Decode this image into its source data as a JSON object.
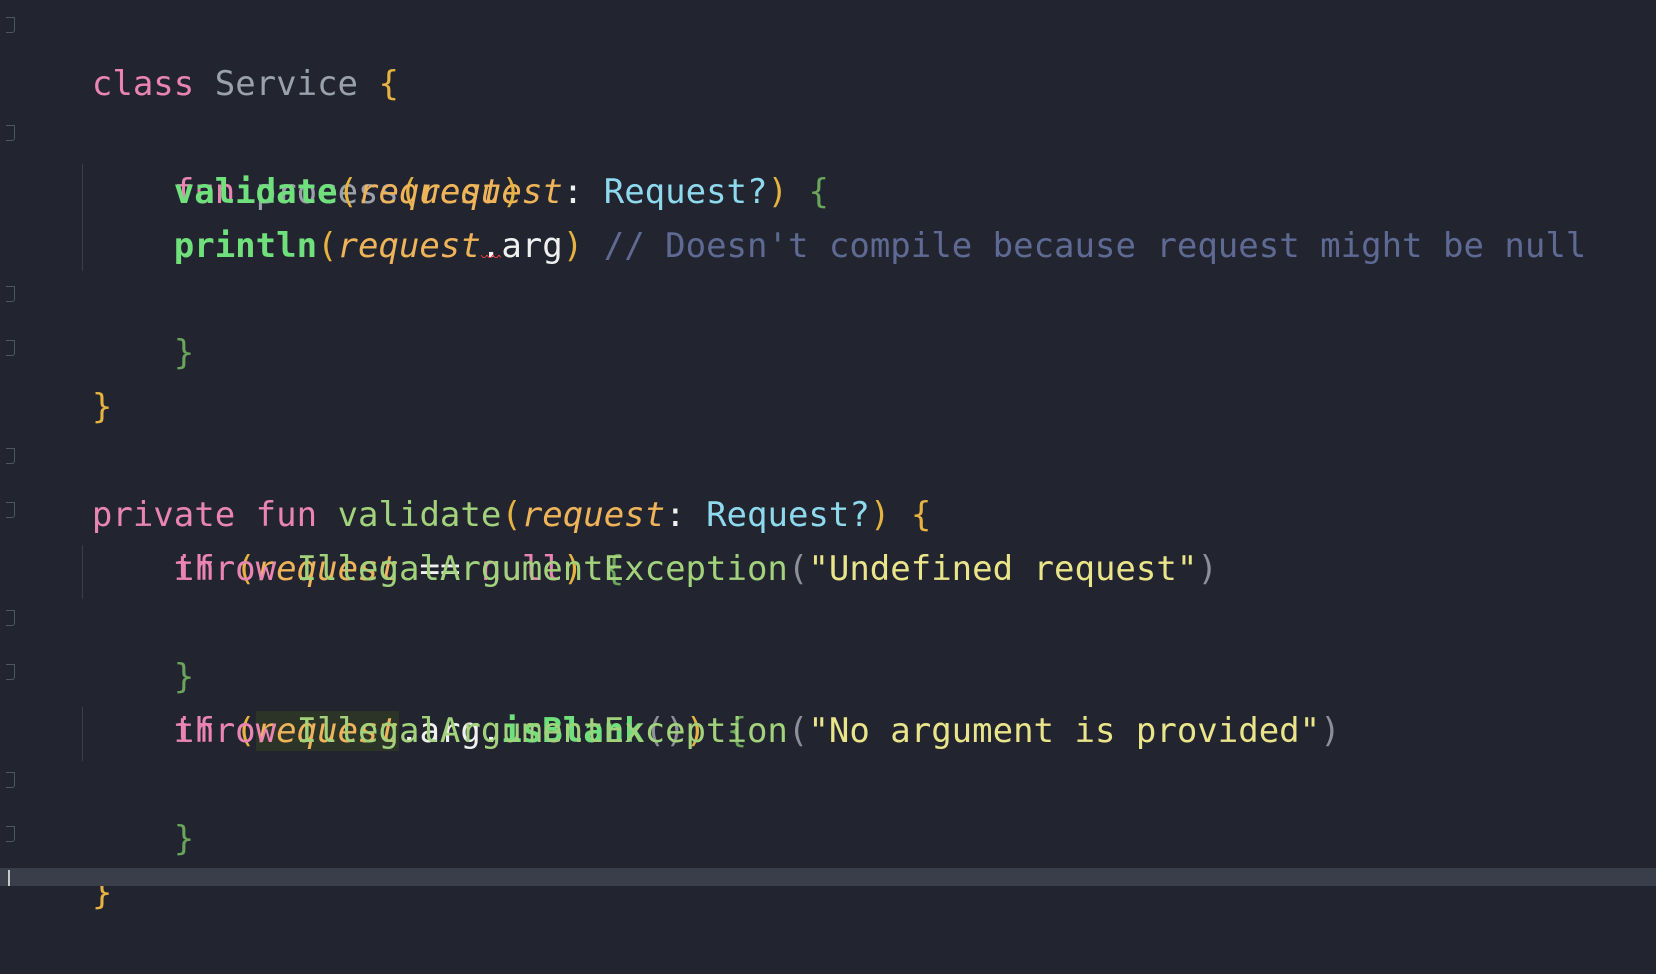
{
  "code": {
    "l1": {
      "kw": "class",
      "name": "Service",
      "brace": "{"
    },
    "l3": {
      "kw": "fun",
      "name": "process",
      "open": "(",
      "param": "request",
      "colon": ": ",
      "type": "Request?",
      "close": ")",
      "brace": "{"
    },
    "l4": {
      "call": "validate",
      "open": "(",
      "param": "request",
      "close": ")"
    },
    "l5": {
      "call": "println",
      "open": "(",
      "param": "request",
      "dot": ".",
      "member": "arg",
      "close": ")",
      "comment": "// Doesn't compile because request might be null"
    },
    "l6": {
      "brace": "}"
    },
    "l7": {
      "brace": "}"
    },
    "l9": {
      "kw1": "private",
      "kw2": "fun",
      "name": "validate",
      "open": "(",
      "param": "request",
      "colon": ": ",
      "type": "Request?",
      "close": ")",
      "brace": "{"
    },
    "l10": {
      "kw": "if",
      "open": "(",
      "param": "request",
      "op": " == ",
      "null": "null",
      "close": ")",
      "brace": "{"
    },
    "l11": {
      "kw": "throw",
      "ex": "IllegalArgumentException",
      "open": "(",
      "str": "\"Undefined request\"",
      "close": ")"
    },
    "l12": {
      "brace": "}"
    },
    "l13": {
      "kw": "if",
      "open": "(",
      "param": "request",
      "member": ".arg.",
      "call": "isBlank",
      "callparens": "()",
      "close": ")",
      "brace": "{"
    },
    "l14": {
      "kw": "throw",
      "ex": "IllegalArgumentException",
      "open": "(",
      "str": "\"No argument is provided\"",
      "close": ")"
    },
    "l15": {
      "brace": "}"
    },
    "l16": {
      "brace": "}"
    }
  },
  "icons": {
    "fold_marker": "fold-marker-icon",
    "cursor": "text-cursor-icon"
  },
  "colors": {
    "background": "#22252f",
    "keyword": "#e984b4",
    "function": "#70e07d",
    "parameter": "#efb45a",
    "type": "#8ed9ee",
    "string": "#eae58a",
    "comment": "#5f6a94",
    "error_squiggle": "#e33d3d"
  }
}
